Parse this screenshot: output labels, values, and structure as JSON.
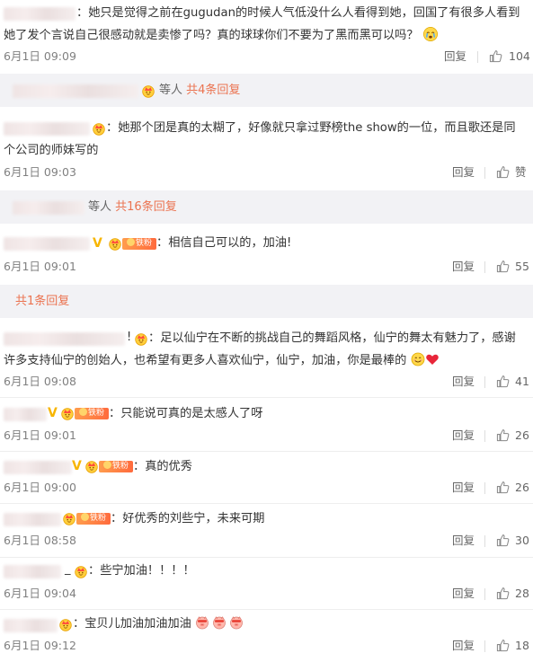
{
  "colors": {
    "accent": "#eb7350",
    "time": "#808080",
    "bar_bg": "#f2f2f5",
    "vip_gold": "#f7b500"
  },
  "comments": [
    {
      "prefix": "：",
      "text": "她只是觉得之前在gugudan的时候人气低没什么人看得到她，回国了有很多人看到",
      "text2": "她了发个言说自己很感动就是卖惨了吗？真的球球你们不要为了黑而黑可以吗？",
      "time": "6月1日 09:09",
      "reply": "回复",
      "likes": "104"
    },
    {
      "prefix": "：",
      "text": "她那个团是真的太糊了，好像就只拿过野榜the show的一位，而且歌还是同",
      "text2": "个公司的师妹写的",
      "time": "6月1日 09:03",
      "reply": "回复",
      "likes": "赞"
    },
    {
      "prefix": "：",
      "text": "相信自己可以的，加油!",
      "time": "6月1日 09:01",
      "reply": "回复",
      "likes": "55"
    },
    {
      "prefix": "：",
      "text": "足以仙宁在不断的挑战自己的舞蹈风格，仙宁的舞太有魅力了，感谢",
      "text2": "许多支持仙宁的创始人，也希望有更多人喜欢仙宁，仙宁，加油，你是最棒的",
      "time": "6月1日 09:08",
      "reply": "回复",
      "likes": "41"
    },
    {
      "prefix": "：",
      "text": "只能说可真的是太感人了呀",
      "time": "6月1日 09:01",
      "reply": "回复",
      "likes": "26"
    },
    {
      "prefix": "：",
      "text": "真的优秀",
      "time": "6月1日 09:00",
      "reply": "回复",
      "likes": "26"
    },
    {
      "prefix": "：",
      "text": "好优秀的刘些宁，未来可期",
      "time": "6月1日 08:58",
      "reply": "回复",
      "likes": "30"
    },
    {
      "prefix": "：",
      "text": "些宁加油！！！！",
      "time": "6月1日 09:04",
      "reply": "回复",
      "likes": "28"
    },
    {
      "prefix": "：",
      "text": "宝贝儿加油加油加油",
      "time": "6月1日 09:12",
      "reply": "回复",
      "likes": "18"
    }
  ],
  "reply_summaries": [
    {
      "others": "等人",
      "link": "共4条回复"
    },
    {
      "others": "等人",
      "link": "共16条回复"
    },
    {
      "link": "共1条回复"
    }
  ],
  "badges": {
    "vip": "V",
    "fan_label": "铁粉",
    "bang": "!",
    "underscore": "_"
  }
}
